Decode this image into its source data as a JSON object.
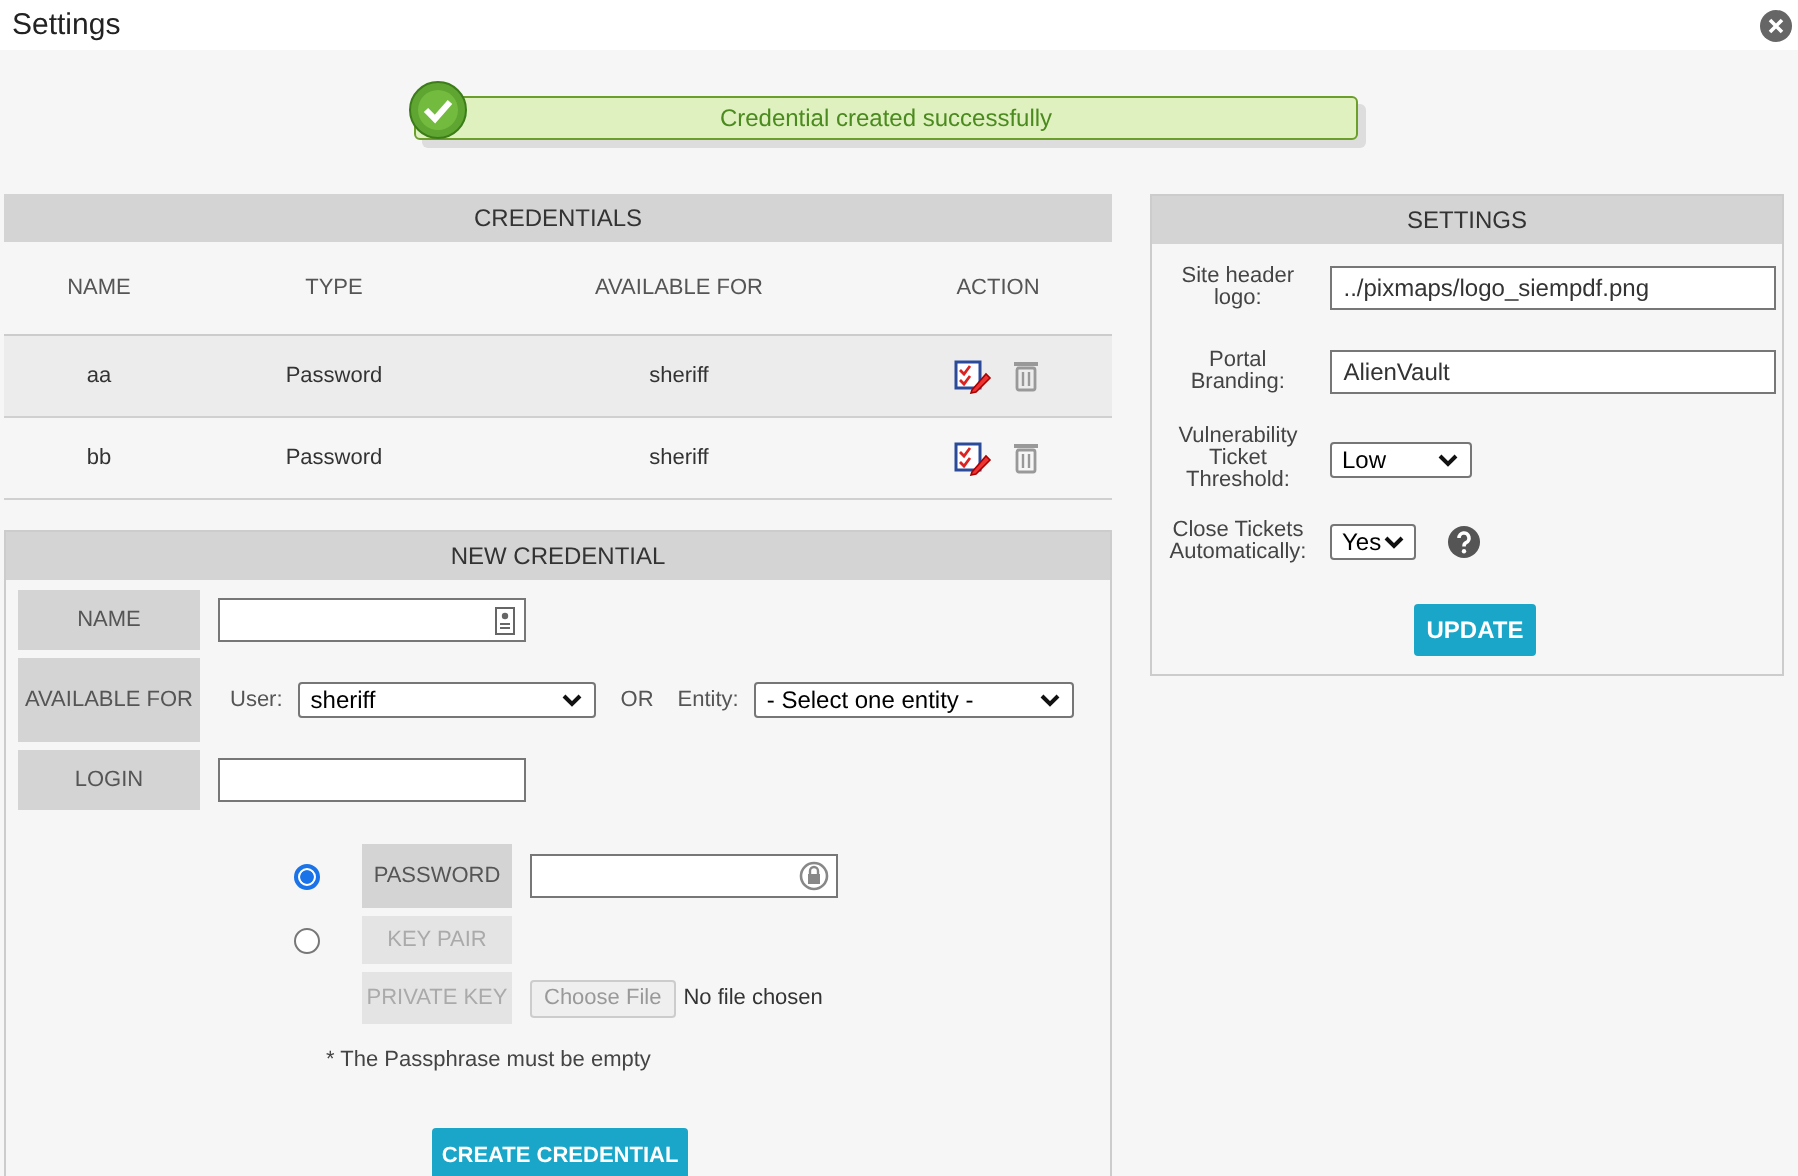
{
  "window": {
    "title": "Settings"
  },
  "toast": {
    "message": "Credential created successfully"
  },
  "credentials": {
    "title": "CREDENTIALS",
    "columns": [
      "NAME",
      "TYPE",
      "AVAILABLE FOR",
      "ACTION"
    ],
    "rows": [
      {
        "name": "aa",
        "type": "Password",
        "available_for": "sheriff"
      },
      {
        "name": "bb",
        "type": "Password",
        "available_for": "sheriff"
      }
    ]
  },
  "new_credential": {
    "title": "NEW CREDENTIAL",
    "name_label": "NAME",
    "available_for_label": "AVAILABLE FOR",
    "user_label": "User:",
    "user_value": "sheriff",
    "or_text": "OR",
    "entity_label": "Entity:",
    "entity_value": "- Select one entity -",
    "login_label": "LOGIN",
    "auth_options": [
      {
        "label": "PASSWORD",
        "selected": true
      },
      {
        "label": "KEY PAIR",
        "selected": false
      }
    ],
    "private_key_label": "PRIVATE KEY",
    "file_button": "Choose File",
    "file_status": "No file chosen",
    "note": "* The Passphrase must be empty",
    "submit": "CREATE CREDENTIAL"
  },
  "settings": {
    "title": "SETTINGS",
    "fields": [
      {
        "label": "Site header logo:",
        "kind": "text",
        "value": "../pixmaps/logo_siempdf.png"
      },
      {
        "label": "Portal Branding:",
        "kind": "text",
        "value": "AlienVault"
      },
      {
        "label": "Vulnerability Ticket Threshold:",
        "kind": "select",
        "value": "Low"
      },
      {
        "label": "Close Tickets Automatically:",
        "kind": "select",
        "value": "Yes",
        "help": true
      }
    ],
    "button": "UPDATE"
  }
}
